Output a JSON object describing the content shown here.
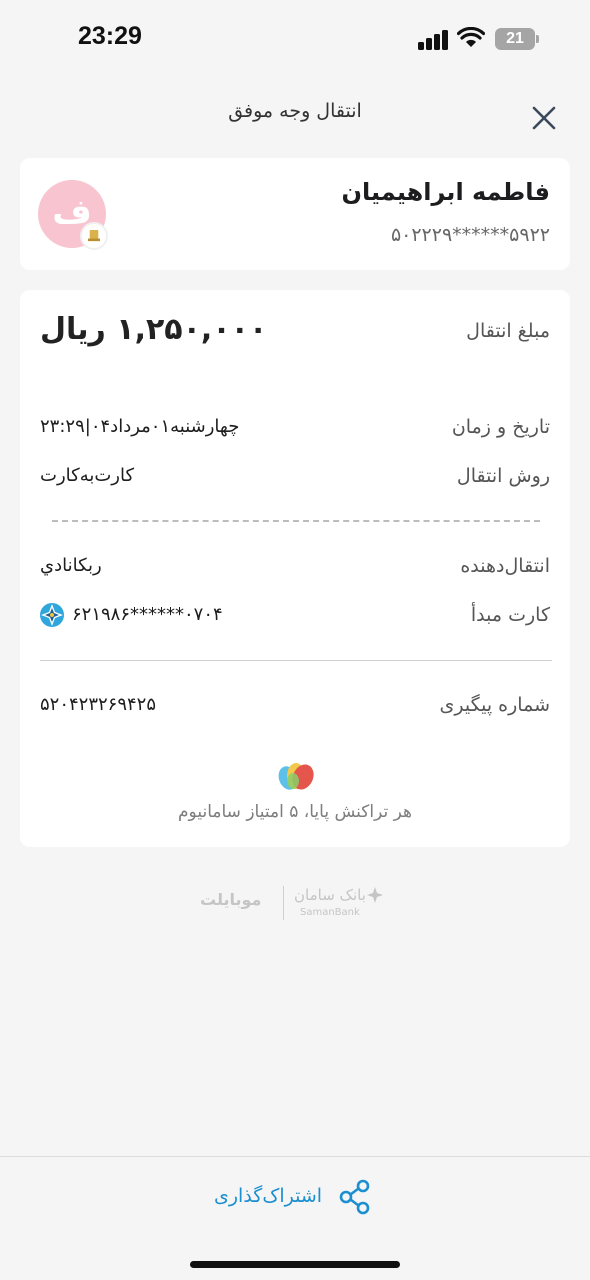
{
  "status_bar": {
    "time": "23:29",
    "battery_level": "21"
  },
  "header": {
    "title": "انتقال وجه موفق",
    "close_icon": "close-icon"
  },
  "recipient": {
    "name": "فاطمه ابراهیمیان",
    "card_number": "۵۰۲۲۲۹******۵۹۲۲",
    "avatar_letter": "ف"
  },
  "details": {
    "amount_label": "مبلغ انتقال",
    "amount_value": "۱,۲۵۰,۰۰۰ ریال",
    "datetime_label": "تاریخ و زمان",
    "datetime_value": "چهارشنبه۰۱مرداد۰۴|۲۳:۲۹",
    "method_label": "روش انتقال",
    "method_value": "کارت‌به‌کارت",
    "sender_label": "انتقال‌دهنده",
    "sender_value": "ربكانادي",
    "source_card_label": "کارت مبدأ",
    "source_card_value": "۶۲۱۹۸۶******۰۷۰۴",
    "tracking_label": "شماره پیگیری",
    "tracking_value": "۵۲۰۴۲۳۲۶۹۴۲۵",
    "reward_text": "هر تراکنش پایا، ۵ امتیاز سامانیوم"
  },
  "footer_logos": {
    "mobilet": "موبایلت",
    "saman_fa": "بانک سامان",
    "saman_en": "SamanBank"
  },
  "actions": {
    "share_label": "اشتراک‌گذاری"
  },
  "colors": {
    "accent": "#1b8fcf",
    "avatar_bg": "#f7c4d0",
    "background": "#f5f5f5"
  }
}
